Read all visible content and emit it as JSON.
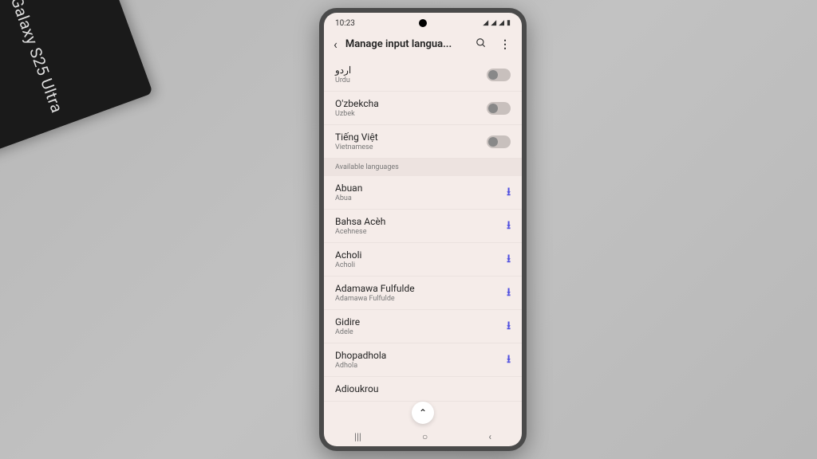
{
  "box": {
    "label": "Galaxy S25 Ultra"
  },
  "status": {
    "time": "10:23"
  },
  "header": {
    "title": "Manage input langua..."
  },
  "toggled_languages": [
    {
      "name": "اردو",
      "sub": "Urdu"
    },
    {
      "name": "O'zbekcha",
      "sub": "Uzbek"
    },
    {
      "name": "Tiếng Việt",
      "sub": "Vietnamese"
    }
  ],
  "section": {
    "header": "Available languages"
  },
  "available_languages": [
    {
      "name": "Abuan",
      "sub": "Abua"
    },
    {
      "name": "Bahsa Acèh",
      "sub": "Acehnese"
    },
    {
      "name": "Acholi",
      "sub": "Acholi"
    },
    {
      "name": "Adamawa Fulfulde",
      "sub": "Adamawa Fulfulde"
    },
    {
      "name": "Gidire",
      "sub": "Adele"
    },
    {
      "name": "Dhopadhola",
      "sub": "Adhola"
    },
    {
      "name": "Adioukrou",
      "sub": ""
    }
  ]
}
